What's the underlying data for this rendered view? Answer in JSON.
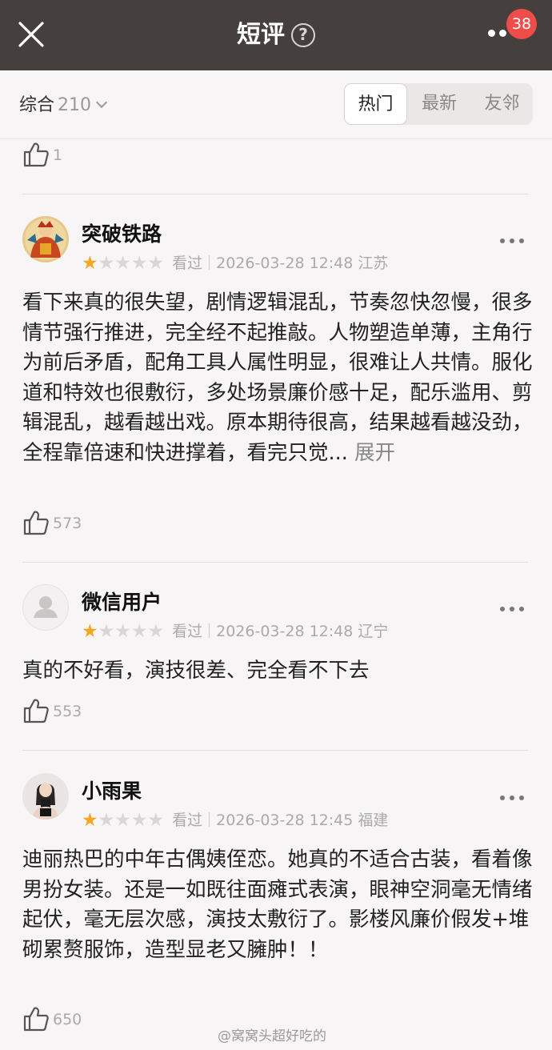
{
  "header": {
    "title": "短评",
    "help_glyph": "?",
    "badge_count": "38"
  },
  "filter": {
    "sort_label": "综合",
    "total": "210",
    "tabs": [
      {
        "label": "热门",
        "active": true
      },
      {
        "label": "最新",
        "active": false
      },
      {
        "label": "友邻",
        "active": false
      }
    ]
  },
  "top_item": {
    "likes": "1"
  },
  "reviews": [
    {
      "user": "突破铁路",
      "rating": 1,
      "status": "看过",
      "datetime": "2026-03-28 12:48",
      "location": "江苏",
      "text": "看下来真的很失望，剧情逻辑混乱，节奏忽快忽慢，很多情节强行推进，完全经不起推敲。人物塑造单薄，主角行为前后矛盾，配角工具人属性明显，很难让人共情。服化道和特效也很敷衍，多处场景廉价感十足，配乐滥用、剪辑混乱，越看越出戏。原本期待很高，结果越看越没劲，全程靠倍速和快进撑着，看完只觉...",
      "expand_label": "展开",
      "likes": "573"
    },
    {
      "user": "微信用户",
      "rating": 1,
      "status": "看过",
      "datetime": "2026-03-28 12:48",
      "location": "辽宁",
      "text": "真的不好看，演技很差、完全看不下去",
      "likes": "553"
    },
    {
      "user": "小雨果",
      "rating": 1,
      "status": "看过",
      "datetime": "2026-03-28 12:45",
      "location": "福建",
      "text": "迪丽热巴的中年古偶姨侄恋。她真的不适合古装，看着像男扮女装。还是一如既往面瘫式表演，眼神空洞毫无情绪起伏，毫无层次感，演技太敷衍了。影楼风廉价假发+堆砌累赘服饰，造型显老又臃肿！！",
      "likes": "650"
    }
  ],
  "watermark": "@窝窝头超好吃的",
  "colors": {
    "header_bg": "#45403d",
    "badge": "#ef4d4a",
    "star_on": "#f5a623",
    "star_off": "#d9d6d5"
  },
  "icons": [
    "close-icon",
    "help-icon",
    "more-icon",
    "chevron-down-icon",
    "thumbs-up-icon",
    "ellipsis-icon",
    "star-icon"
  ]
}
